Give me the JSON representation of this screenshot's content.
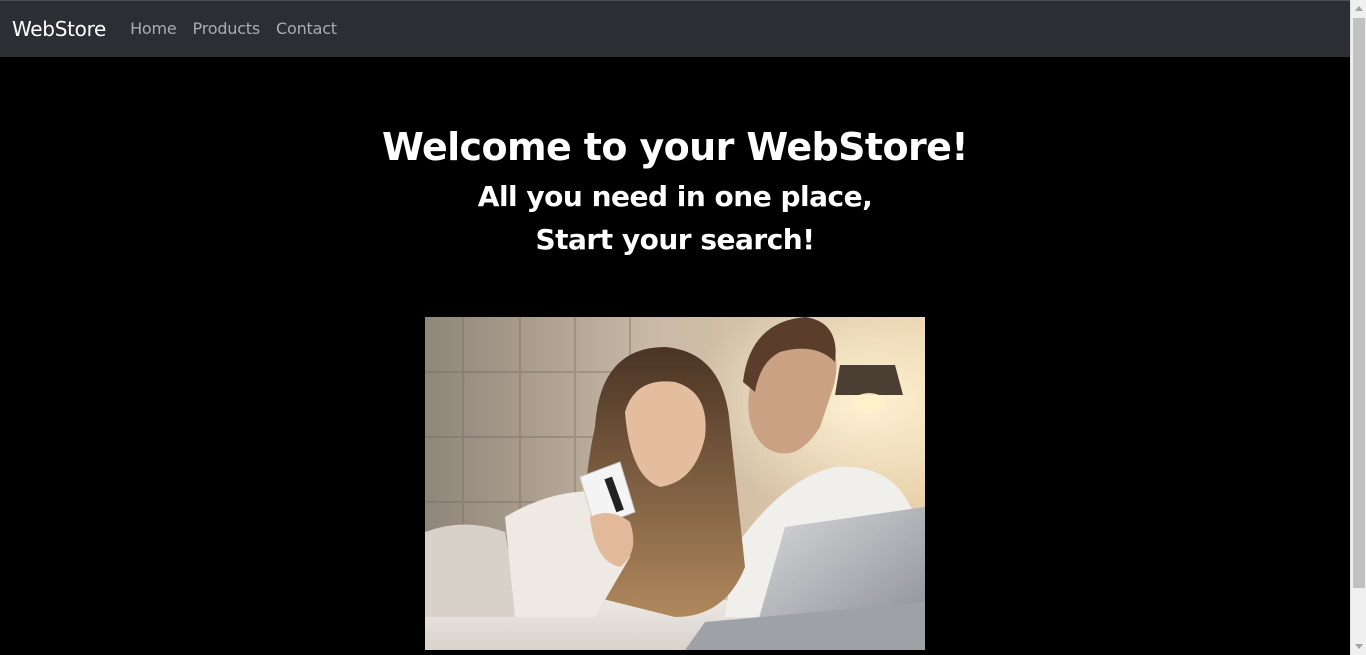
{
  "navbar": {
    "brand": "WebStore",
    "links": [
      {
        "label": "Home"
      },
      {
        "label": "Products"
      },
      {
        "label": "Contact"
      }
    ]
  },
  "hero": {
    "title": "Welcome to your WebStore!",
    "subtitle_line1": "All you need in one place,",
    "subtitle_line2": "Start your search!"
  },
  "colors": {
    "navbar_bg": "#2b2f33",
    "page_bg": "#000000",
    "heading_text": "#ffffff",
    "nav_link_text": "#a9adb1"
  }
}
